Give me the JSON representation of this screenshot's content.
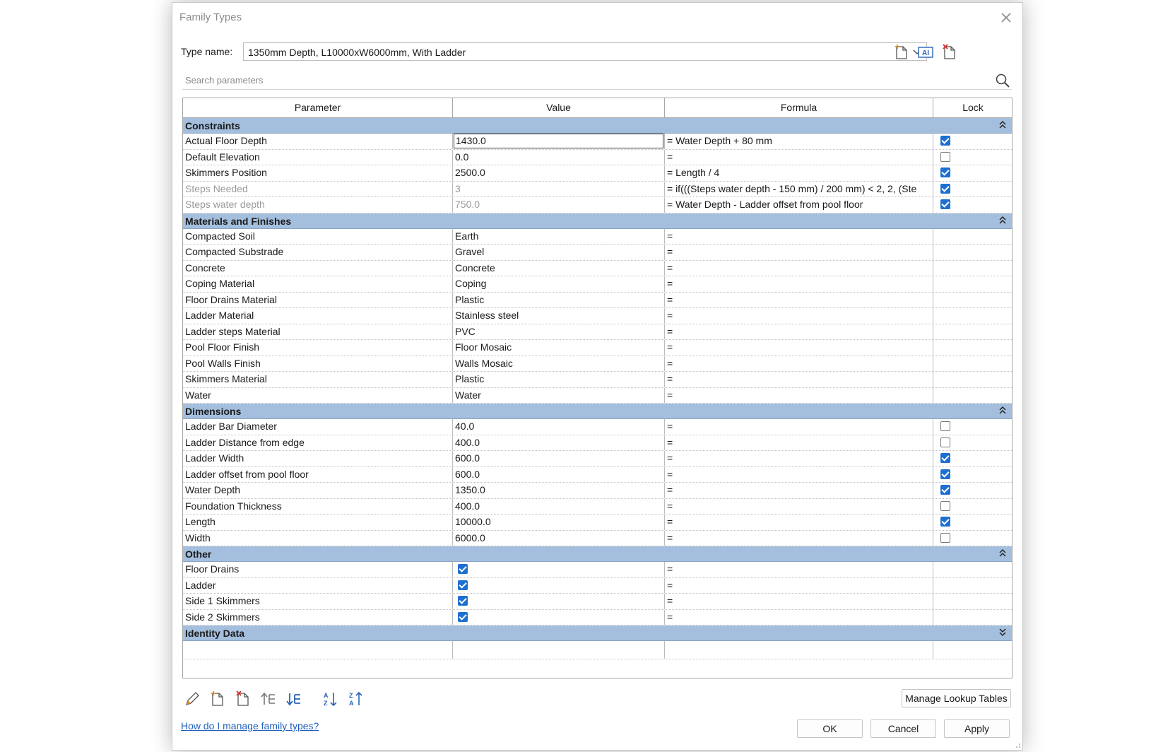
{
  "dialog": {
    "title": "Family Types",
    "type_name_label": "Type name:",
    "type_name_value": "1350mm Depth, L10000xW6000mm, With Ladder",
    "search_placeholder": "Search parameters"
  },
  "columns": [
    "Parameter",
    "Value",
    "Formula",
    "Lock"
  ],
  "groups": [
    {
      "title": "Constraints",
      "collapsed": false,
      "rows": [
        {
          "param": "Actual Floor Depth",
          "value": "1430.0",
          "formula": "= Water Depth + 80 mm",
          "lock": true,
          "editing": true
        },
        {
          "param": "Default Elevation",
          "value": "0.0",
          "formula": "=",
          "lock": false
        },
        {
          "param": "Skimmers Position",
          "value": "2500.0",
          "formula": "= Length / 4",
          "lock": true
        },
        {
          "param": "Steps Needed",
          "value": "3",
          "formula": "= if(((Steps water depth - 150 mm) / 200 mm) < 2, 2, (Ste",
          "lock": true,
          "dim": true
        },
        {
          "param": "Steps water depth",
          "value": "750.0",
          "formula": "= Water Depth - Ladder offset from pool floor",
          "lock": true,
          "dim": true
        }
      ]
    },
    {
      "title": "Materials and Finishes",
      "collapsed": false,
      "rows": [
        {
          "param": "Compacted Soil",
          "value": "Earth",
          "formula": "="
        },
        {
          "param": "Compacted Substrade",
          "value": "Gravel",
          "formula": "="
        },
        {
          "param": "Concrete",
          "value": "Concrete",
          "formula": "="
        },
        {
          "param": "Coping Material",
          "value": "Coping",
          "formula": "="
        },
        {
          "param": "Floor Drains Material",
          "value": "Plastic",
          "formula": "="
        },
        {
          "param": "Ladder Material",
          "value": "Stainless steel",
          "formula": "="
        },
        {
          "param": "Ladder steps Material",
          "value": "PVC",
          "formula": "="
        },
        {
          "param": "Pool Floor Finish",
          "value": "Floor Mosaic",
          "formula": "="
        },
        {
          "param": "Pool Walls Finish",
          "value": "Walls Mosaic",
          "formula": "="
        },
        {
          "param": "Skimmers Material",
          "value": "Plastic",
          "formula": "="
        },
        {
          "param": "Water",
          "value": "Water",
          "formula": "="
        }
      ]
    },
    {
      "title": "Dimensions",
      "collapsed": false,
      "rows": [
        {
          "param": "Ladder Bar Diameter",
          "value": "40.0",
          "formula": "=",
          "lock": false
        },
        {
          "param": "Ladder Distance from edge",
          "value": "400.0",
          "formula": "=",
          "lock": false
        },
        {
          "param": "Ladder Width",
          "value": "600.0",
          "formula": "=",
          "lock": true
        },
        {
          "param": "Ladder offset from pool floor",
          "value": "600.0",
          "formula": "=",
          "lock": true
        },
        {
          "param": "Water Depth",
          "value": "1350.0",
          "formula": "=",
          "lock": true
        },
        {
          "param": "Foundation Thickness",
          "value": "400.0",
          "formula": "=",
          "lock": false
        },
        {
          "param": "Length",
          "value": "10000.0",
          "formula": "=",
          "lock": true
        },
        {
          "param": "Width",
          "value": "6000.0",
          "formula": "=",
          "lock": false
        }
      ]
    },
    {
      "title": "Other",
      "collapsed": false,
      "rows": [
        {
          "param": "Floor Drains",
          "value_check": true,
          "formula": "="
        },
        {
          "param": "Ladder",
          "value_check": true,
          "formula": "="
        },
        {
          "param": "Side 1 Skimmers",
          "value_check": true,
          "formula": "="
        },
        {
          "param": "Side 2 Skimmers",
          "value_check": true,
          "formula": "="
        }
      ]
    },
    {
      "title": "Identity Data",
      "collapsed": true,
      "rows": []
    }
  ],
  "toolbar_icons": [
    "edit-parameter-icon",
    "new-parameter-icon",
    "delete-parameter-icon",
    "move-up-icon",
    "move-down-icon",
    "sort-ascending-icon",
    "sort-descending-icon"
  ],
  "buttons": {
    "manage_lookup": "Manage Lookup Tables",
    "ok": "OK",
    "cancel": "Cancel",
    "apply": "Apply"
  },
  "help_link": "How do I manage family types?",
  "colors": {
    "group_header": "#a4bfdd",
    "checkbox_on": "#1e6fd0",
    "link": "#1f5fbf"
  }
}
